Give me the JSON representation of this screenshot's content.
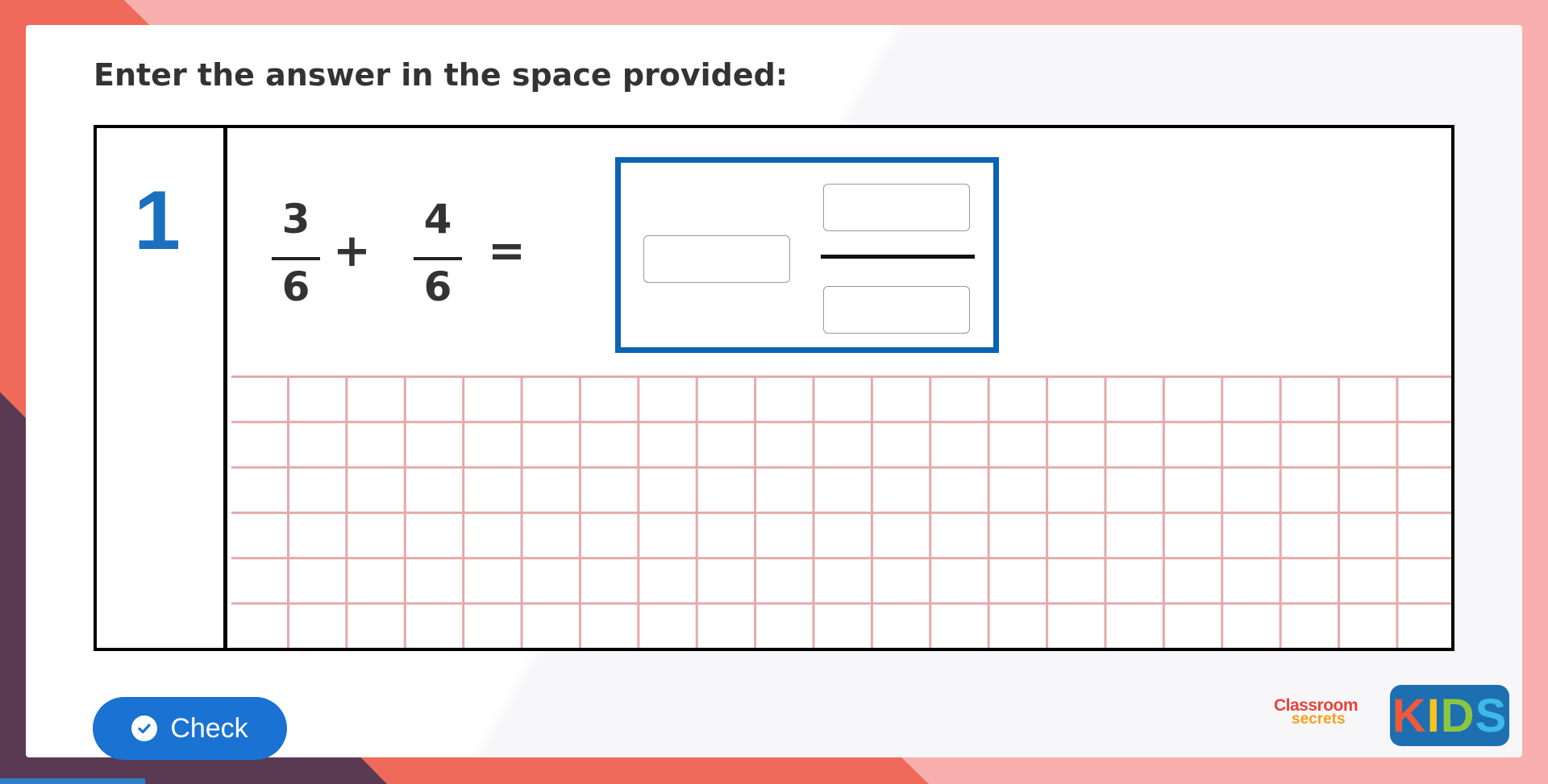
{
  "instruction": "Enter the answer in the space provided:",
  "question": {
    "number": "1",
    "fraction_a": {
      "numerator": "3",
      "denominator": "6"
    },
    "operator": "+",
    "fraction_b": {
      "numerator": "4",
      "denominator": "6"
    },
    "equals": "=",
    "answer": {
      "whole_value": "",
      "numerator_value": "",
      "denominator_value": ""
    }
  },
  "check_button": {
    "label": "Check",
    "icon": "check-circle-icon"
  },
  "logo": {
    "line1": "Classroom",
    "line2": "secrets",
    "kids": [
      "K",
      "I",
      "D",
      "S"
    ]
  },
  "colors": {
    "accent_blue": "#1a72d2",
    "answer_border": "#0b63b3",
    "number_blue": "#1a6fc0",
    "grid_line": "#e4aaaa"
  }
}
